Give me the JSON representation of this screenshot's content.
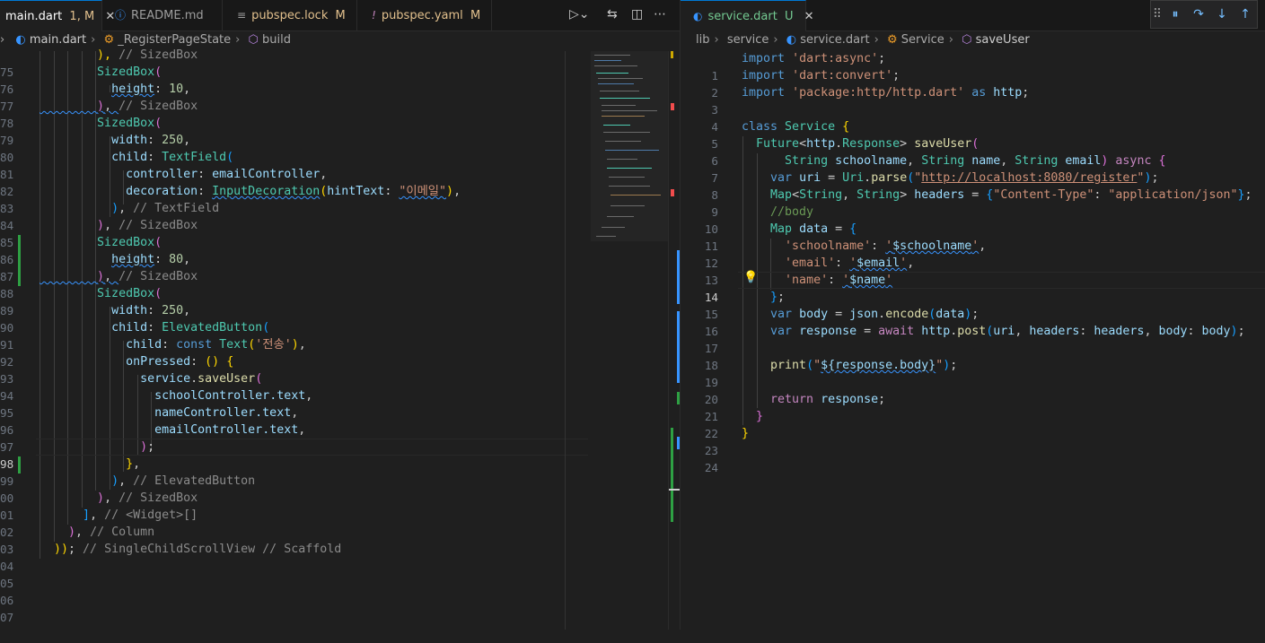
{
  "left_tabs": [
    {
      "icon": "dart-icon",
      "label": "main.dart",
      "badge": "1, M",
      "active": true
    },
    {
      "icon": "info-icon",
      "label": "README.md",
      "badge": ""
    },
    {
      "icon": "lines-icon",
      "label": "pubspec.lock",
      "badge": "M"
    },
    {
      "icon": "exclamation-icon",
      "label": "pubspec.yaml",
      "badge": "M"
    }
  ],
  "right_tabs": [
    {
      "icon": "dart-icon",
      "label": "service.dart",
      "badge": "U",
      "active": true
    }
  ],
  "left_breadcrumb": [
    "main.dart",
    "_RegisterPageState",
    "build"
  ],
  "right_breadcrumb": [
    "lib",
    "service",
    "service.dart",
    "Service",
    "saveUser"
  ],
  "left_line_numbers": [
    "75",
    "76",
    "77",
    "78",
    "79",
    "80",
    "81",
    "82",
    "83",
    "84",
    "85",
    "86",
    "87",
    "88",
    "89",
    "90",
    "91",
    "92",
    "93",
    "94",
    "95",
    "96",
    "97",
    "98",
    "99",
    "00",
    "01",
    "02",
    "03",
    "04",
    "05",
    "06",
    "07"
  ],
  "right_line_numbers": [
    "1",
    "2",
    "3",
    "4",
    "5",
    "6",
    "7",
    "8",
    "9",
    "10",
    "11",
    "12",
    "13",
    "14",
    "15",
    "16",
    "17",
    "18",
    "19",
    "20",
    "21",
    "22",
    "23",
    "24"
  ],
  "right_current_line": "14",
  "left_code": {
    "l75": "), ",
    "l75c": "// SizedBox",
    "sizedbox": "SizedBox",
    "height": "height",
    "h10": "10",
    "h80": "80",
    "width": "width",
    "w250": "250",
    "child": "child",
    "textfield": "TextField",
    "controller": "controller",
    "emailController": "emailController",
    "decoration": "decoration",
    "inputDecoration": "InputDecoration",
    "hintText": "hintText",
    "hint_value": "\"이메일\"",
    "c_textfield": "// TextField",
    "c_sizedbox": "// SizedBox",
    "elevatedButton": "ElevatedButton",
    "const": "const",
    "text": "Text",
    "send": "'전송'",
    "onPressed": "onPressed",
    "service": "service",
    "saveUser": "saveUser",
    "schoolController": "schoolController",
    "nameController": "nameController",
    "emailController2": "emailController",
    "dot_text": ".text",
    "c_elevated": "// ElevatedButton",
    "c_widget": "// <Widget>[]",
    "c_column": "// Column",
    "c_scaffold": "// SingleChildScrollView // Scaffold"
  },
  "right_code": {
    "import": "import",
    "as": "as",
    "imp1": "'dart:async'",
    "imp2": "'dart:convert'",
    "imp3": "'package:http/http.dart'",
    "http": "http",
    "class": "class",
    "Service": "Service",
    "Future": "Future",
    "Response": "Response",
    "saveUser": "saveUser",
    "String": "String",
    "schoolname": "schoolname",
    "name": "name",
    "email": "email",
    "async": "async",
    "var": "var",
    "uri": "uri",
    "Uri": "Uri",
    "parse": "parse",
    "url": "http://localhost:8080/register",
    "Map": "Map",
    "headers": "headers",
    "ct_key": "\"Content-Type\"",
    "ct_val": "\"application/json\"",
    "c_body": "//body",
    "data": "data",
    "k_school": "'schoolname'",
    "v_school": "$schoolname",
    "k_email": "'email'",
    "v_email": "$email",
    "k_name": "'name'",
    "v_name": "$name",
    "body": "body",
    "json": "json",
    "encode": "encode",
    "response": "response",
    "await": "await",
    "post": "post",
    "print": "print",
    "interp": "${response.body}",
    "return": "return"
  },
  "colors": {
    "background": "#1f1f1f",
    "tab_bar": "#181818",
    "accent": "#0078d4",
    "modified": "#e2c08d"
  }
}
